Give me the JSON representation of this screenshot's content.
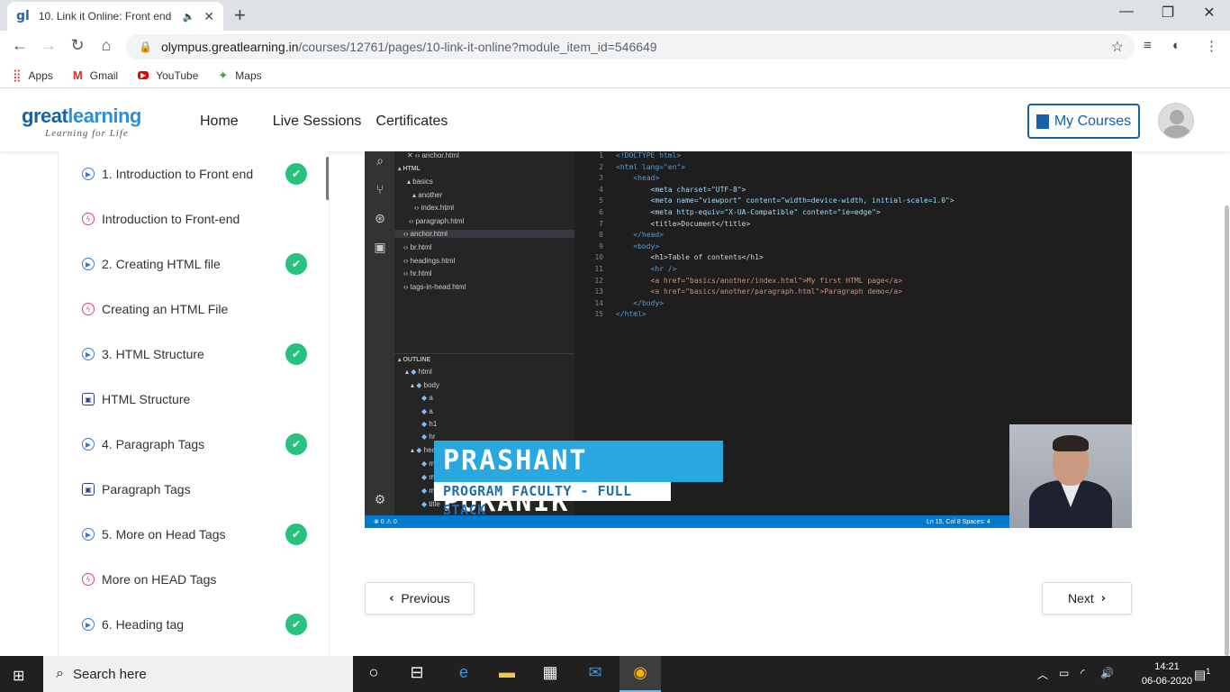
{
  "browser": {
    "tab_favicon": "gl",
    "tab_title": "10. Link it Online: Front end",
    "tab_audio": "audio-icon",
    "url_host": "olympus.greatlearning.in",
    "url_path": "/courses/12761/pages/10-link-it-online?module_item_id=546649",
    "bookmarks": [
      "Apps",
      "Gmail",
      "YouTube",
      "Maps"
    ]
  },
  "site": {
    "logo_main_a": "great",
    "logo_main_b": "learning",
    "logo_tagline": "Learning for Life",
    "nav": [
      "Home",
      "Live Sessions",
      "Certificates"
    ],
    "my_courses": "My Courses"
  },
  "sidebar": {
    "items": [
      {
        "label": "1. Introduction to Front end",
        "icon": "play-icon",
        "done": true
      },
      {
        "label": "Introduction to Front-end",
        "icon": "bolt-icon",
        "done": false
      },
      {
        "label": "2. Creating HTML file",
        "icon": "play-icon",
        "done": true
      },
      {
        "label": "Creating an HTML File",
        "icon": "bolt-icon",
        "done": false
      },
      {
        "label": "3. HTML Structure",
        "icon": "play-icon",
        "done": true
      },
      {
        "label": "HTML Structure",
        "icon": "doc-icon",
        "done": false
      },
      {
        "label": "4. Paragraph Tags",
        "icon": "play-icon",
        "done": true
      },
      {
        "label": "Paragraph Tags",
        "icon": "doc-icon",
        "done": false
      },
      {
        "label": "5. More on Head Tags",
        "icon": "play-icon",
        "done": true
      },
      {
        "label": "More on HEAD Tags",
        "icon": "bolt-icon",
        "done": false
      },
      {
        "label": "6. Heading tag",
        "icon": "play-icon",
        "done": true
      }
    ]
  },
  "video": {
    "explorer": {
      "open_file": "anchor.html",
      "folder": "HTML",
      "tree": [
        "basics",
        "another",
        "index.html",
        "paragraph.html",
        "anchor.html",
        "br.html",
        "headings.html",
        "hr.html",
        "tags-in-head.html"
      ],
      "outline_title": "OUTLINE",
      "outline": [
        "html",
        "body",
        "a",
        "a",
        "h1",
        "hr",
        "head",
        "meta",
        "meta",
        "meta",
        "title"
      ]
    },
    "code_lines": [
      "<!DOCTYPE html>",
      "<html lang=\"en\">",
      "<head>",
      "<meta charset=\"UTF-8\">",
      "<meta name=\"viewport\" content=\"width=device-width, initial-scale=1.0\">",
      "<meta http-equiv=\"X-UA-Compatible\" content=\"ie=edge\">",
      "<title>Document</title>",
      "</head>",
      "<body>",
      "<h1>Table of contents</h1>",
      "<hr />",
      "<a href=\"basics/another/index.html\">My first HTML page</a>",
      "<a href=\"basics/another/paragraph.html\">Paragraph demo</a>",
      "</body>",
      "</html>"
    ],
    "status_left": "⊗ 0 ⚠ 0",
    "status_right": "Ln 15, Col 8    Spaces: 4",
    "presenter_name": "PRASHANT PURANIK",
    "presenter_role": "PROGRAM FACULTY - FULL STACK"
  },
  "pager": {
    "previous": "Previous",
    "next": "Next"
  },
  "taskbar": {
    "search_placeholder": "Search here",
    "time": "14:21",
    "date": "06-06-2020",
    "notifications": "1"
  }
}
